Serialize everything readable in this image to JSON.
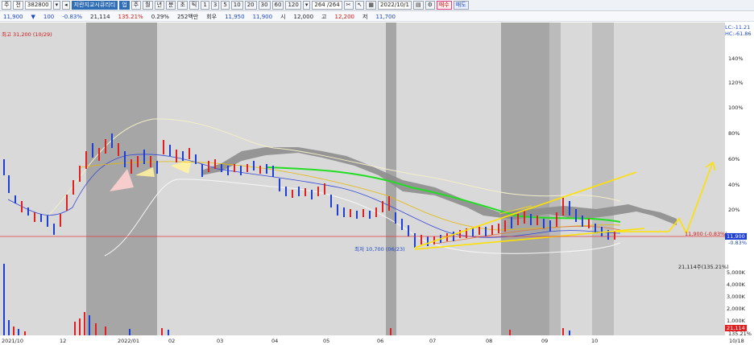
{
  "toolbar": {
    "period": "주",
    "market": "전",
    "code": "382800",
    "stock_name": "지란지교시큐리티",
    "tag": "업",
    "periods": [
      "주",
      "월",
      "년",
      "분",
      "초",
      "틱"
    ],
    "intervals": [
      "1",
      "3",
      "5",
      "10",
      "20",
      "30",
      "60",
      "120"
    ],
    "page": "264 /264",
    "date": "2022/10/1",
    "buy_label": "매수",
    "sell_label": "매도"
  },
  "quote": {
    "price": "11,900",
    "change": "100",
    "change_pct": "-0.83%",
    "volume": "21,114",
    "volume_ratio": "135.21%",
    "turnover_pct": "0.29%",
    "amount": "252백만",
    "prev_label": "회우",
    "prev": "11,950",
    "open": "11,900",
    "high_label": "시",
    "open2": "12,000",
    "high_label2": "고",
    "high": "12,200",
    "low_label": "저",
    "low": "11,700"
  },
  "chart": {
    "indicator_lc": "LC:-11.21",
    "indicator_hc": "HC:-61.86",
    "high_annotation": "최고 31,200 (10/29)",
    "low_annotation": "최저 10,700 (06/23)",
    "price_annotation": "11,900 (-0.83%)",
    "current_price_tag": "11,900",
    "current_pct_tag": "-0.83%",
    "volume_annotation": "21,114주(135.21%)",
    "volume_tag": "21,114",
    "volume_pct_tag": "135.21%",
    "pct_axis": [
      "140%",
      "120%",
      "100%",
      "80%",
      "60%",
      "40%",
      "20%"
    ],
    "pct_values": [
      140,
      120,
      100,
      80,
      60,
      40,
      20
    ],
    "vol_axis": [
      "5,000K",
      "4,000K",
      "3,000K",
      "2,000K",
      "1,000K"
    ],
    "vol_values": [
      5000,
      4000,
      3000,
      2000,
      1000
    ],
    "date_axis": [
      "2021/10",
      "12",
      "2022/01",
      "02",
      "03",
      "04",
      "05",
      "06",
      "07",
      "08",
      "09",
      "10",
      "10/18"
    ]
  },
  "colors": {
    "up": "#e02020",
    "down": "#1e3fd6",
    "cloud": "#9a9a9a",
    "trend_yellow": "#ffe100",
    "ma_green": "#22dd22",
    "bollinger": "#f0ecc0"
  }
}
